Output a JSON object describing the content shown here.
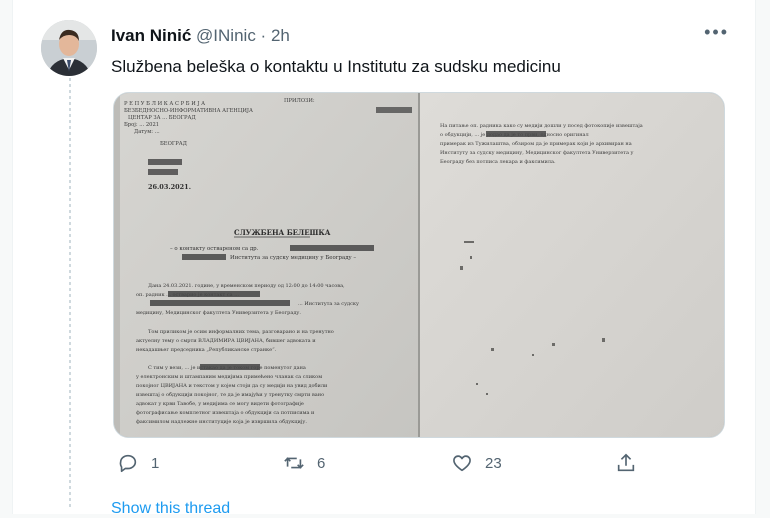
{
  "tweet": {
    "author": {
      "name": "Ivan Ninić",
      "handle": "@INinic",
      "separator": "·",
      "time": "2h"
    },
    "text": "Službena beleška o kontaktu u Institutu za sudsku medicinu",
    "media": {
      "left": {
        "header_lines": [
          "Р Е П У Б Л И К А   С Р Б И Ј А",
          "БЕЗБЕДНОСНО-ИНФОРМАТИВНА АГЕНЦИЈА",
          "ЦЕНТАР ЗА ... БЕОГРАД",
          "Број: ... 2021",
          "Датум: ...",
          "БЕОГРАД"
        ],
        "stamp_label": "ПРИЛОЗИ:",
        "date": "26.03.2021.",
        "title": "СЛУЖБЕНА БЕЛЕШКА",
        "subtitle_1": "– о контакту оствареном са др.",
        "subtitle_2": "Института за судску медицину у Београду –",
        "para1": [
          "Дана 24.03.2021. године, у временском периоду од 12:00 до 14:00 часова,",
          "оп. радник ... остварио је контакт са ...",
          "... Института за судску",
          "медицину, Медицинског факултета Универзитета у Београду."
        ],
        "para2": [
          "Том приликом је осим информалних тема, разговарано и на тренутно",
          "актуелну тему о смрти ВЛАДИМИРА ЦВИЈАНА, бившег адвоката и",
          "некадашњег председника „Републиканске странке“."
        ],
        "para3": [
          "С тим у вези, ... је истакао да је током горе поменутог дана",
          "у електронским и штампаним медијима примећено чланак са сликом",
          "покојног ЦВИЈАНА и текстом у којем стоји да су медији на увид добили",
          "извештај о обдукцији покојног, те да је имајући у тренутку смрти вано",
          "адвокат у крви Тавобе, у медијима се могу видети фотографије",
          "фотографисање комплетног извештаја о обдукцији са потписима и",
          "факсимилом надлежне институције која је извршила обдукцију."
        ]
      },
      "right": {
        "para": [
          "На питање оп. радника како су медији дошли у посед фотокопије извештаја",
          "о обдукцији, ... је додао да је то први, односно оригинал",
          "примерак из Тужилаштва, обзиром да је примерак који је архивиран на",
          "Институту за судску медицину, Медицинског факултета Универзитета у",
          "Београду без потписа лекара и факсимила."
        ]
      }
    },
    "actions": {
      "reply_count": "1",
      "retweet_count": "6",
      "like_count": "23"
    },
    "show_thread": "Show this thread"
  },
  "colors": {
    "accent": "#1d9bf0",
    "secondary_text": "#536471"
  }
}
